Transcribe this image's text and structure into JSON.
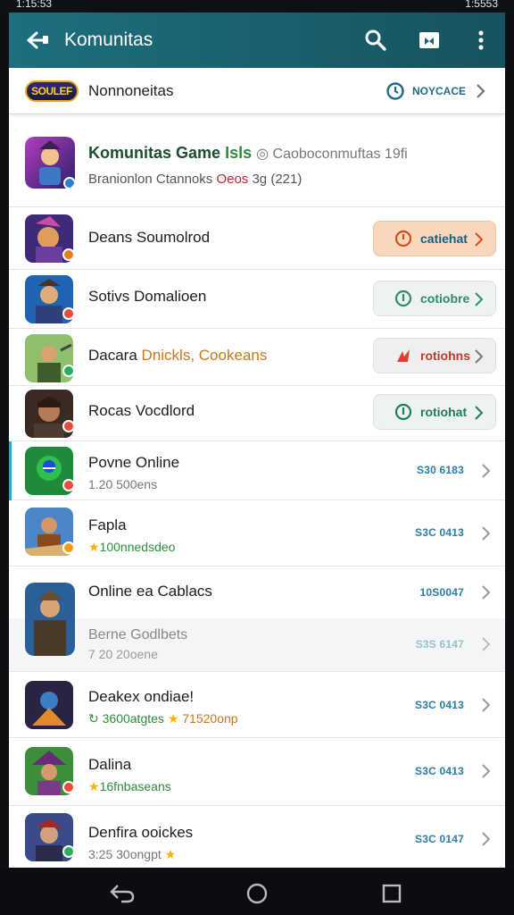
{
  "status_bar": {
    "time": "1:15:53",
    "battery": "1:5553"
  },
  "appbar": {
    "title": "Komunitas"
  },
  "banner": {
    "title": "Nonnoneitas",
    "logo_text": "SOULEF",
    "action_label": "NOYCACE"
  },
  "header_card": {
    "title_main": "Komunitas Game",
    "title_green": "Isls",
    "title_grey": "Caoboconmuftas 19fi",
    "subtitle_main": "Branionlon Ctannoks",
    "subtitle_red": "Oeos",
    "subtitle_tail": "3g (221)"
  },
  "rows": [
    {
      "name": "Deans Soumolrod",
      "button_label": "catiehat",
      "button_style": "orange"
    },
    {
      "name": "Sotivs Domalioen",
      "button_label": "cotiobre",
      "button_style": "green"
    },
    {
      "name_main": "Dacara",
      "name_orange": "Dnickls, Cookeans",
      "button_label": "rotiohns",
      "button_style": "red"
    },
    {
      "name": "Rocas Vocdlord",
      "button_label": "rotiohat",
      "button_style": "green2"
    },
    {
      "name": "Povne Online",
      "sub": "1.20 500ens",
      "value": "S30 6183"
    },
    {
      "name": "Fapla",
      "sub": "100nnedsdeo",
      "value": "S3C 0413"
    },
    {
      "name": "Online ea Cablacs",
      "value": "10S0047"
    },
    {
      "name": "Berne Godlbets",
      "sub": "7 20 20oene",
      "value": "S3S 6147"
    },
    {
      "name": "Deakex ondiae!",
      "sub_green": "3600atgtes",
      "sub_orange": "71520onp",
      "value": "S3C 0413"
    },
    {
      "name": "Dalina",
      "sub": "16fnbaseans",
      "value": "S3C 0413"
    },
    {
      "name": "Denfira ooickes",
      "sub": "3:25 30ongpt",
      "value": "S3C 0147"
    }
  ],
  "colors": {
    "appbar": "#1d6f7e",
    "accent_blue": "#2a7fa8",
    "orange_pill": "#f7d9c1",
    "green_text": "#2f8c3c",
    "star": "#f4b400"
  },
  "icons": {
    "back": "arrow-left-icon",
    "search": "search-icon",
    "cast": "cast-icon",
    "more": "more-vert-icon"
  }
}
